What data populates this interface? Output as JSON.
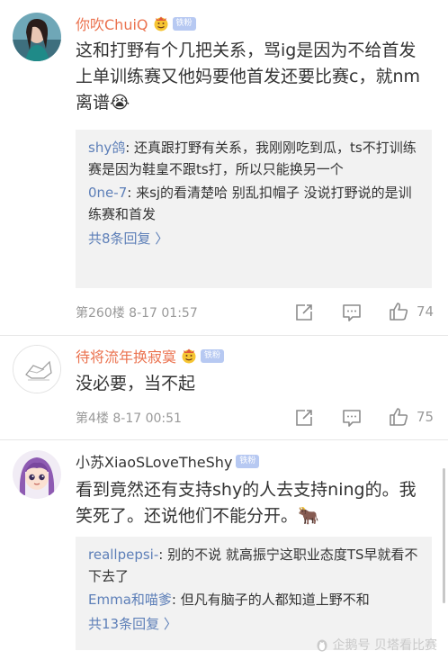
{
  "comments": [
    {
      "username": "你吹ChuiQ",
      "fan_badge": "铁粉",
      "text": "这和打野有个几把关系，骂ig是因为不给首发上单训练赛又他妈要他首发还要比赛c，就nm离谱😭",
      "replies": [
        {
          "user": "shy鸽",
          "text": ": 还真跟打野有关系，我刚刚吃到瓜，ts不打训练赛是因为鞋皇不跟ts打，所以只能换另一个"
        },
        {
          "user": "0ne-7",
          "text": ": 来sj的看清楚哈 别乱扣帽子 没说打野说的是训练赛和首发"
        }
      ],
      "more_replies": "共8条回复 〉",
      "floor_time": "第260楼  8-17 01:57",
      "like_count": "74"
    },
    {
      "username": "待将流年换寂寞",
      "fan_badge": "铁粉",
      "text": "没必要，当不起",
      "floor_time": "第4楼  8-17 00:51",
      "like_count": "75"
    },
    {
      "username": "小苏XiaoSLoveTheShy",
      "fan_badge": "铁粉",
      "text": "看到竟然还有支持shy的人去支持ning的。我笑死了。还说他们不能分开。🐂",
      "replies": [
        {
          "user": "reallpepsi-",
          "text": ": 别的不说 就高振宁这职业态度TS早就看不下去了"
        },
        {
          "user": "Emma和喵爹",
          "text": ": 但凡有脑子的人都知道上野不和"
        }
      ],
      "more_replies": "共13条回复 〉"
    }
  ],
  "watermark": "企鹅号 贝塔看比赛",
  "colors": {
    "username": "#eb7350",
    "reply_user": "#5d7fb8",
    "meta": "#999999",
    "reply_bg": "#f2f2f2"
  }
}
